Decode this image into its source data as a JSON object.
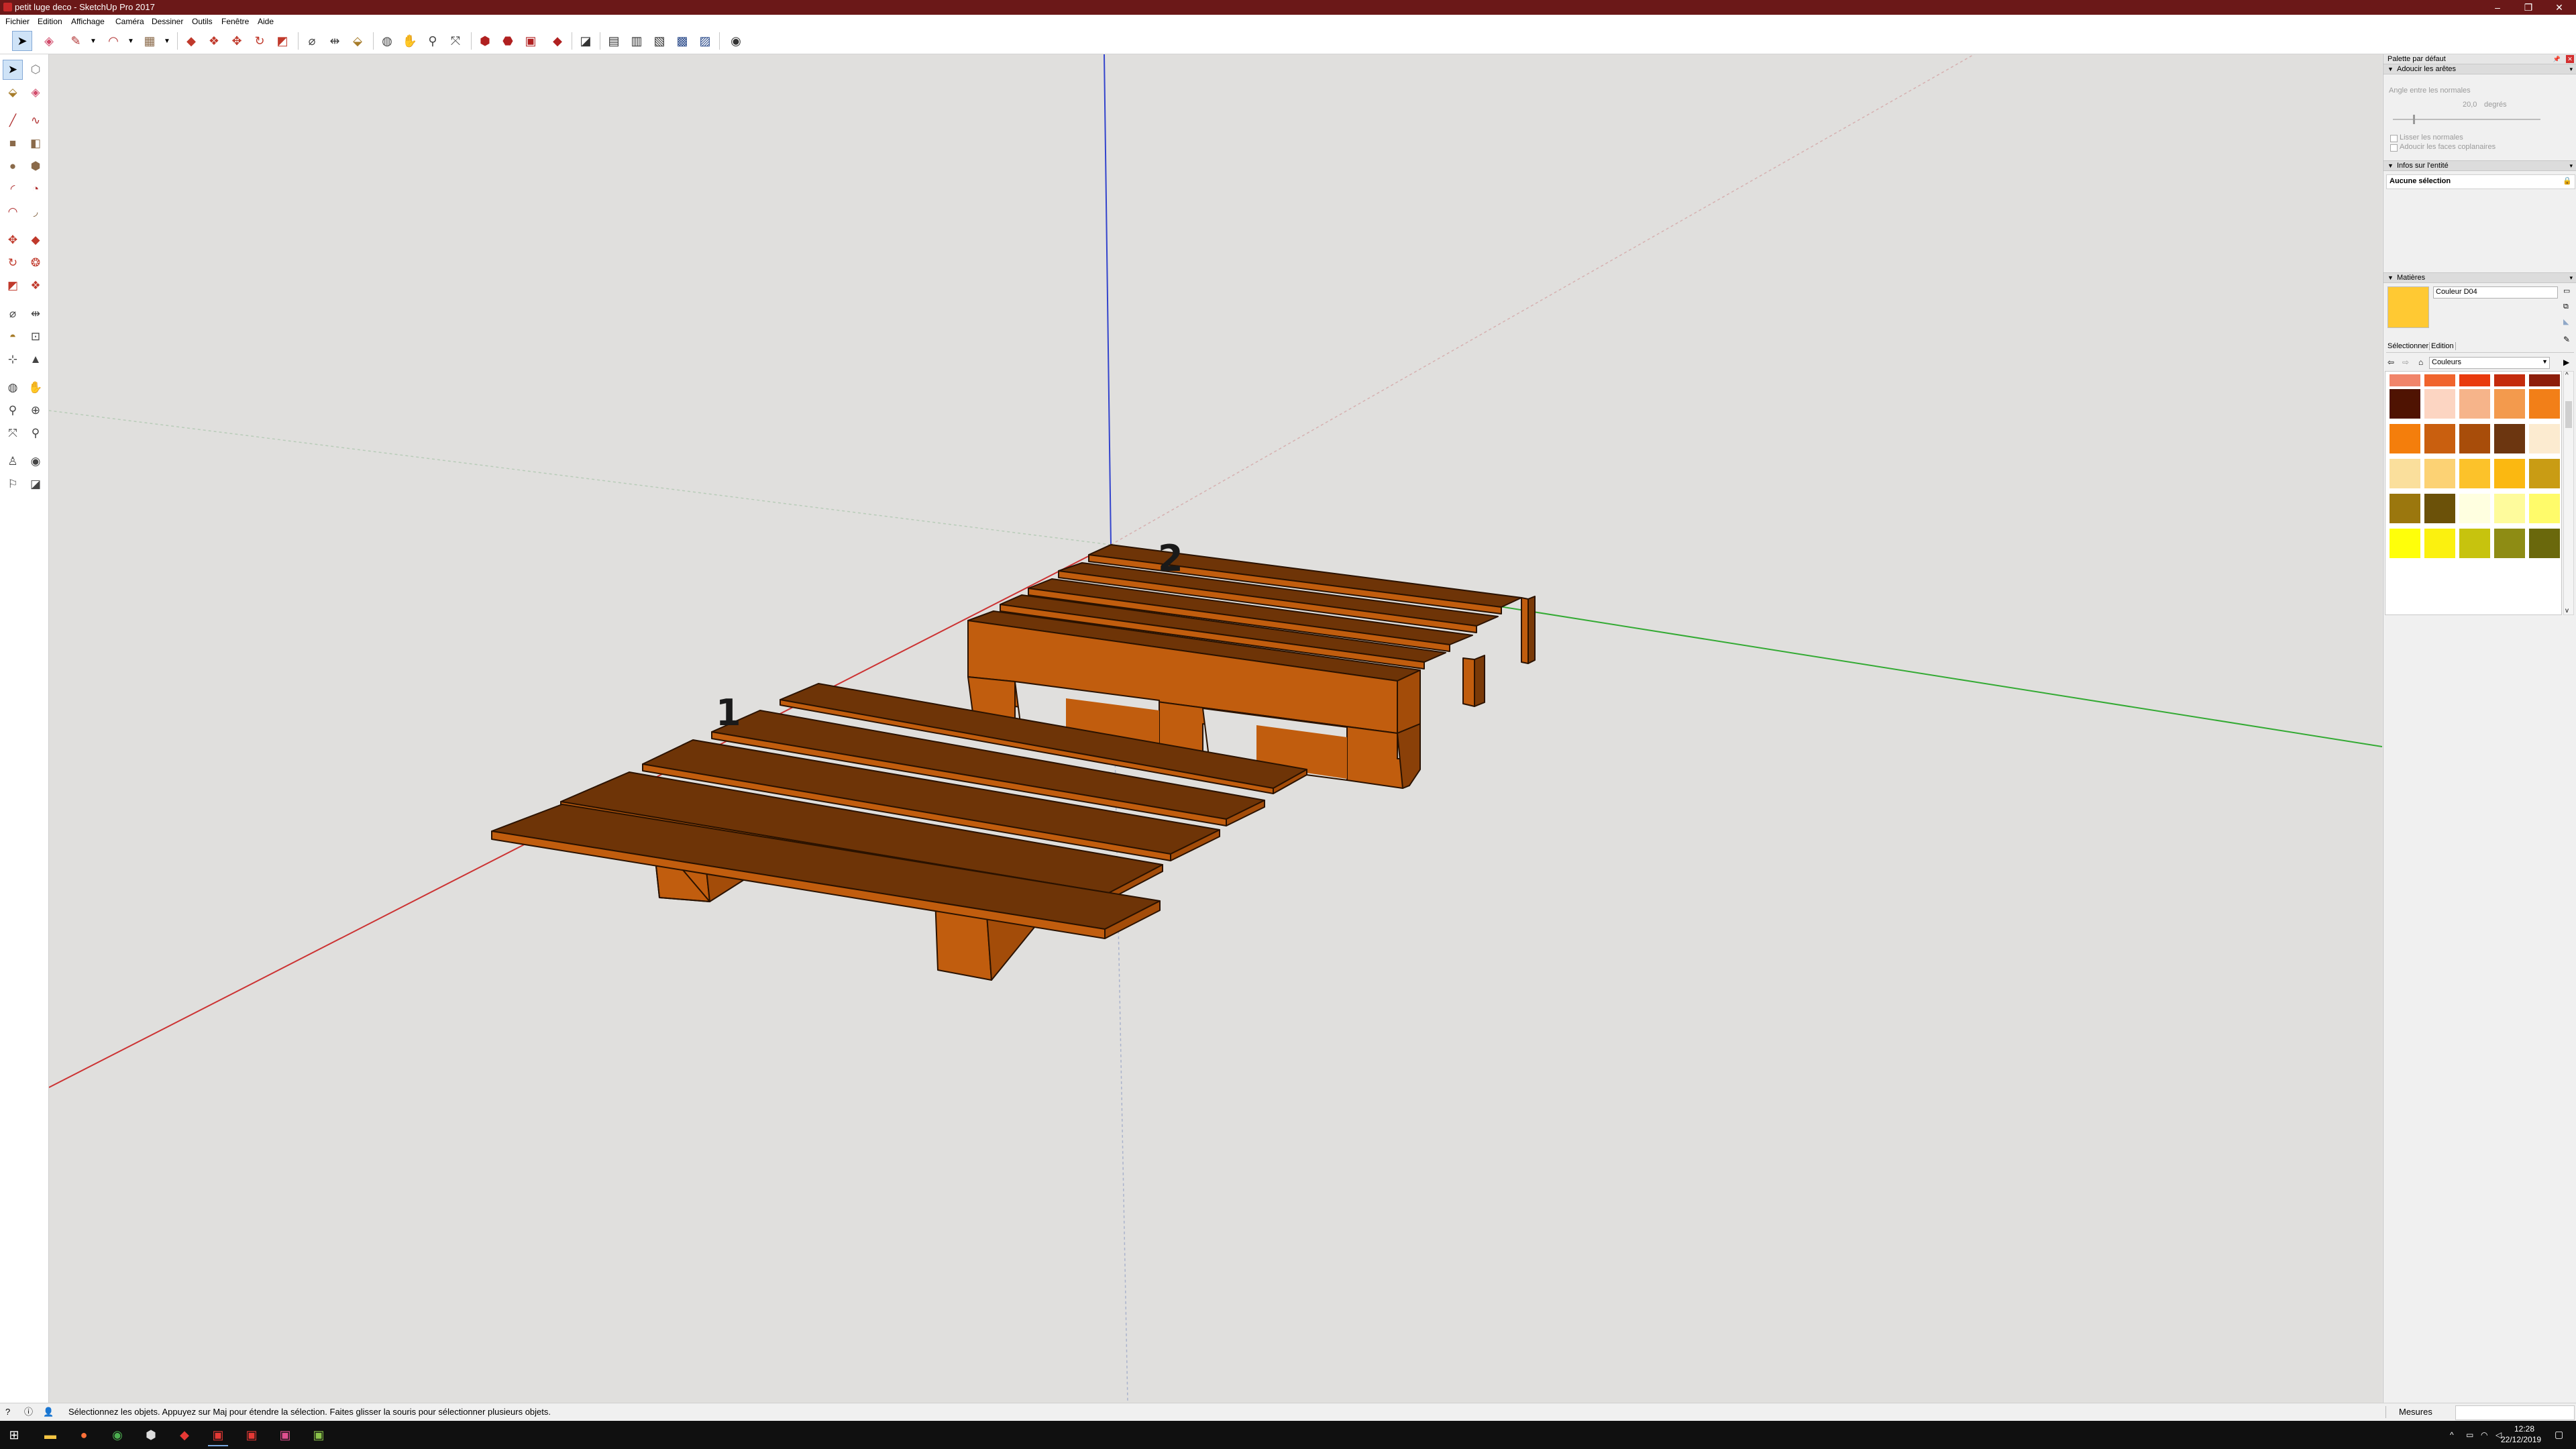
{
  "window": {
    "title": "petit luge deco - SketchUp Pro 2017",
    "controls": [
      "–",
      "❐",
      "✕"
    ]
  },
  "menu": [
    "Fichier",
    "Edition",
    "Affichage",
    "Caméra",
    "Dessiner",
    "Outils",
    "Fenêtre",
    "Aide"
  ],
  "toolbar_icons": [
    "select-icon",
    "eraser-icon",
    "pencil-icon",
    "dropdown-arrow-icon",
    "arc-icon",
    "dropdown-arrow-icon",
    "shape-icon",
    "dropdown-arrow-icon",
    "push-pull-icon",
    "offset-icon",
    "move-icon",
    "rotate-icon",
    "scale-icon",
    "tape-measure-icon",
    "dimension-icon",
    "paint-bucket-icon",
    "orbit-icon",
    "pan-icon",
    "zoom-icon",
    "zoom-extents-icon",
    "warehouse-icon",
    "extension-warehouse-icon",
    "layout-icon",
    "ruby-icon",
    "section-plane-icon",
    "section-display-icon",
    "section-cuts-icon",
    "section-fill-icon",
    "section-plane-2-icon",
    "add-location-icon"
  ],
  "left_tools": [
    [
      "select-icon",
      "make-component-icon"
    ],
    [
      "paint-bucket-icon",
      "eraser-icon"
    ],
    [
      "line-icon",
      "freehand-icon"
    ],
    [
      "rectangle-icon",
      "rotated-rectangle-icon"
    ],
    [
      "circle-icon",
      "polygon-icon"
    ],
    [
      "arc-icon",
      "pie-icon"
    ],
    [
      "two-point-arc-icon",
      "three-point-arc-icon"
    ],
    [
      "move-icon",
      "push-pull-icon"
    ],
    [
      "rotate-icon",
      "follow-me-icon"
    ],
    [
      "scale-icon",
      "offset-icon"
    ],
    [
      "tape-measure-icon",
      "dimension-icon"
    ],
    [
      "protractor-icon",
      "text-icon"
    ],
    [
      "axes-icon",
      "3d-text-icon"
    ],
    [
      "orbit-icon",
      "pan-icon"
    ],
    [
      "zoom-icon",
      "zoom-window-icon"
    ],
    [
      "zoom-extents-icon",
      "previous-view-icon"
    ],
    [
      "position-camera-icon",
      "look-around-icon"
    ],
    [
      "walk-icon",
      "section-plane-icon"
    ]
  ],
  "viewport": {
    "labels": [
      "1",
      "2"
    ]
  },
  "right_panel": {
    "tray_title": "Palette par défaut",
    "soften": {
      "header": "Adoucir les arêtes",
      "angle_label": "Angle entre les normales",
      "angle_value": "20,0",
      "angle_unit": "degrés",
      "smooth_normals": "Lisser les normales",
      "soften_coplanar": "Adoucir les faces coplanaires"
    },
    "entity_info": {
      "header": "Infos sur l'entité",
      "selection": "Aucune sélection"
    },
    "materials": {
      "header": "Matières",
      "current_name": "Couleur D04",
      "current_color": "#FFC933",
      "tab_select": "Sélectionner",
      "tab_edit": "Edition",
      "collection": "Couleurs",
      "swatches": [
        "#F1856A",
        "#F0642D",
        "#E93A0D",
        "#C42B0C",
        "#8D1E0B",
        "#4F1302",
        "#FCD5C2",
        "#F6B48A",
        "#F39A4D",
        "#F27F18",
        "#F47E0C",
        "#C95F0F",
        "#A84D0A",
        "#6C3610",
        "#FCEBD0",
        "#FADF9C",
        "#FCD274",
        "#FCC22A",
        "#FBB811",
        "#C99C14",
        "#9B770E",
        "#6B5109",
        "#FFFFE0",
        "#FEFB9C",
        "#FFFB6A",
        "#FFFF0A",
        "#FBF10F",
        "#C7C30E",
        "#8E8C14",
        "#6A680C"
      ]
    }
  },
  "status": {
    "message": "Sélectionnez les objets. Appuyez sur Maj pour étendre la sélection. Faites glisser la souris pour sélectionner plusieurs objets.",
    "measure_label": "Mesures"
  },
  "taskbar": {
    "apps": [
      "windows-start-icon",
      "file-explorer-icon",
      "firefox-icon",
      "chrome-icon",
      "sketchup-icon",
      "sketchup-2-icon",
      "sketchup-layout-icon",
      "sketchup-style-icon",
      "app-icon",
      "app-2-icon"
    ],
    "time": "12:28",
    "date": "22/12/2019"
  },
  "colors": {
    "titlebar": "#6b1818",
    "wood_top": "#6e3407",
    "wood_side": "#c15d0e",
    "wood_front": "#a34c09"
  }
}
